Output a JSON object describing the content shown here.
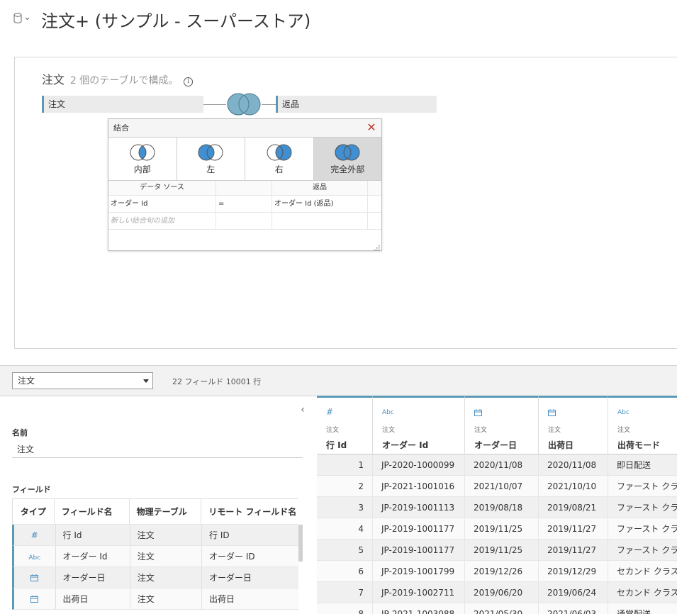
{
  "header": {
    "title": "注文+ (サンプル - スーパーストア)"
  },
  "canvas": {
    "title": "注文",
    "subtitle": "2 個のテーブルで構成。",
    "left_table": "注文",
    "right_table": "返品"
  },
  "join_dialog": {
    "title": "結合",
    "types": [
      {
        "label": "内部",
        "selected": false
      },
      {
        "label": "左",
        "selected": false
      },
      {
        "label": "右",
        "selected": false
      },
      {
        "label": "完全外部",
        "selected": true
      }
    ],
    "clause_headers": {
      "left": "データ ソース",
      "right": "返品"
    },
    "clause": {
      "left": "オーダー Id",
      "op": "=",
      "right": "オーダー Id (返品)"
    },
    "add_clause": "新しい結合句の追加"
  },
  "toolbar": {
    "table_select": "注文",
    "field_count": "22 フィールド 10001 行"
  },
  "metadata": {
    "name_label": "名前",
    "name_value": "注文",
    "fields_label": "フィールド",
    "columns": [
      "タイプ",
      "フィールド名",
      "物理テーブル",
      "リモート フィールド名"
    ],
    "rows": [
      {
        "type": "#",
        "name": "行 Id",
        "table": "注文",
        "remote": "行 ID"
      },
      {
        "type": "Abc",
        "name": "オーダー Id",
        "table": "注文",
        "remote": "オーダー ID"
      },
      {
        "type": "date",
        "name": "オーダー日",
        "table": "注文",
        "remote": "オーダー日"
      },
      {
        "type": "date",
        "name": "出荷日",
        "table": "注文",
        "remote": "出荷日"
      }
    ]
  },
  "grid": {
    "columns": [
      {
        "type": "#",
        "source": "注文",
        "name": "行 Id"
      },
      {
        "type": "Abc",
        "source": "注文",
        "name": "オーダー Id"
      },
      {
        "type": "date",
        "source": "注文",
        "name": "オーダー日"
      },
      {
        "type": "date",
        "source": "注文",
        "name": "出荷日"
      },
      {
        "type": "Abc",
        "source": "注文",
        "name": "出荷モード"
      }
    ],
    "rows": [
      [
        "1",
        "JP-2020-1000099",
        "2020/11/08",
        "2020/11/08",
        "即日配送"
      ],
      [
        "2",
        "JP-2021-1001016",
        "2021/10/07",
        "2021/10/10",
        "ファースト クラス"
      ],
      [
        "3",
        "JP-2019-1001113",
        "2019/08/18",
        "2019/08/21",
        "ファースト クラス"
      ],
      [
        "4",
        "JP-2019-1001177",
        "2019/11/25",
        "2019/11/27",
        "ファースト クラス"
      ],
      [
        "5",
        "JP-2019-1001177",
        "2019/11/25",
        "2019/11/27",
        "ファースト クラス"
      ],
      [
        "6",
        "JP-2019-1001799",
        "2019/12/26",
        "2019/12/29",
        "セカンド クラス"
      ],
      [
        "7",
        "JP-2019-1002711",
        "2019/06/20",
        "2019/06/24",
        "セカンド クラス"
      ],
      [
        "8",
        "JP-2021-1003088",
        "2021/05/30",
        "2021/06/03",
        "通常配送"
      ]
    ]
  },
  "colors": {
    "accent": "#5b9ab5",
    "venn_fill": "#3f8fd2",
    "venn_main": "#7fb2c8",
    "close": "#c0392b"
  }
}
